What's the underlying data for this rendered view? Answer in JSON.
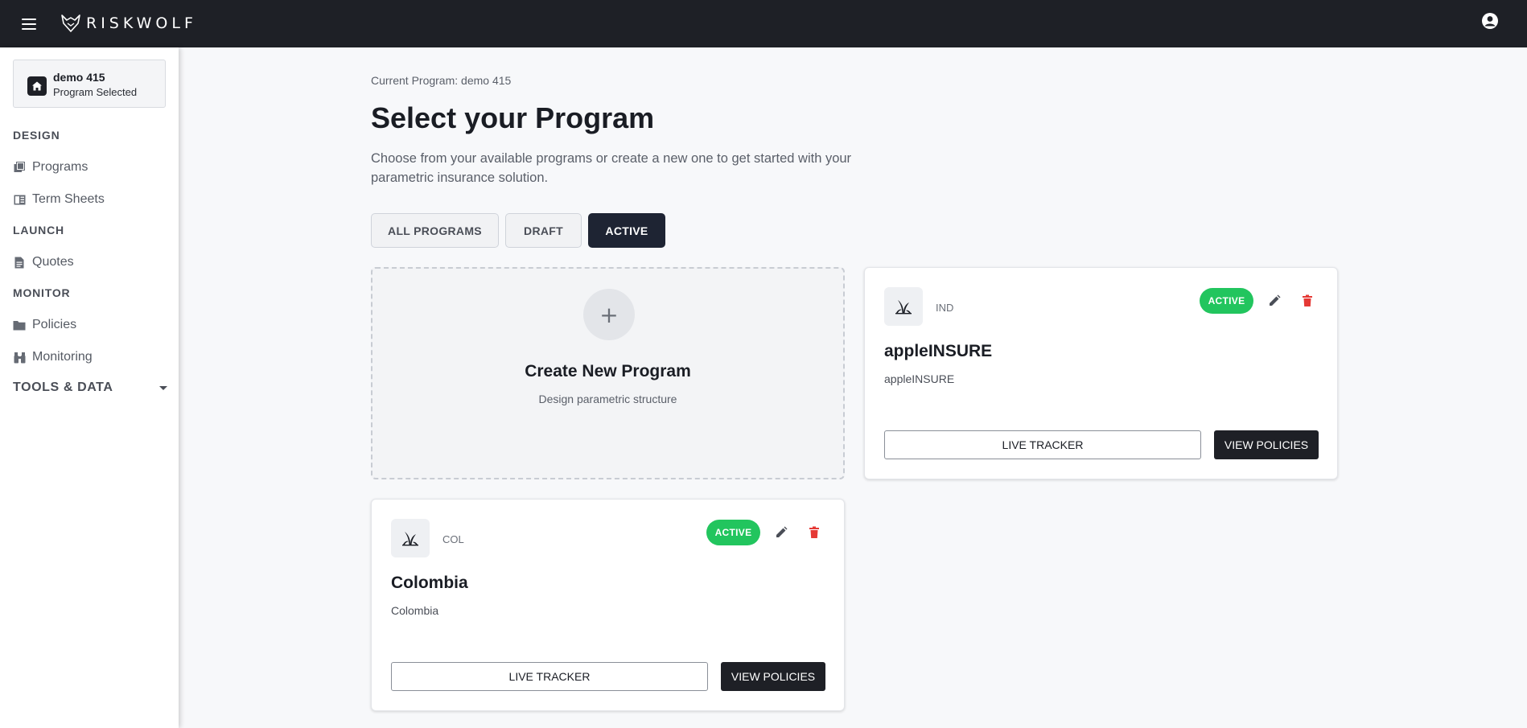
{
  "header": {
    "brand": "RISKWOLF"
  },
  "sidebar": {
    "current_program": {
      "name": "demo 415",
      "status": "Program Selected"
    },
    "sections": {
      "design": "DESIGN",
      "launch": "LAUNCH",
      "monitor": "MONITOR",
      "tools": "TOOLS & DATA"
    },
    "items": [
      {
        "label": "Programs",
        "icon": "programs-icon"
      },
      {
        "label": "Term Sheets",
        "icon": "term-sheets-icon"
      },
      {
        "label": "Quotes",
        "icon": "document-icon"
      },
      {
        "label": "Policies",
        "icon": "folder-icon"
      },
      {
        "label": "Monitoring",
        "icon": "binoculars-icon"
      }
    ]
  },
  "main": {
    "breadcrumb": "Current Program: demo 415",
    "title": "Select your Program",
    "subtitle": "Choose from your available programs or create a new one to get started with your parametric insurance solution.",
    "tabs": [
      {
        "label": "ALL PROGRAMS",
        "active": false
      },
      {
        "label": "DRAFT",
        "active": false
      },
      {
        "label": "ACTIVE",
        "active": true
      }
    ],
    "create_card": {
      "plus": "+",
      "title": "Create New Program",
      "subtitle": "Design parametric structure"
    },
    "programs": [
      {
        "code": "IND",
        "status": "ACTIVE",
        "name": "appleINSURE",
        "description": "appleINSURE",
        "live_tracker_label": "LIVE TRACKER",
        "view_policies_label": "VIEW POLICIES"
      },
      {
        "code": "COL",
        "status": "ACTIVE",
        "name": "Colombia",
        "description": "Colombia",
        "live_tracker_label": "LIVE TRACKER",
        "view_policies_label": "VIEW POLICIES"
      }
    ]
  },
  "colors": {
    "header_bg": "#1e2026",
    "active_badge": "#22c55e",
    "delete_red": "#e53935",
    "active_tab": "#1e2433"
  }
}
